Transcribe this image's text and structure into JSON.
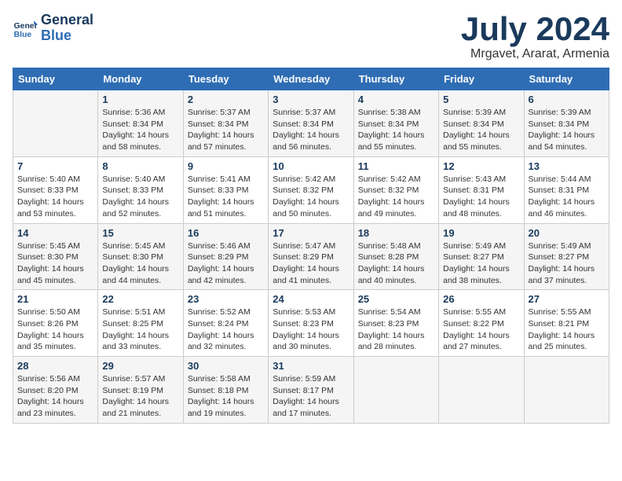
{
  "logo": {
    "line1": "General",
    "line2": "Blue"
  },
  "title": "July 2024",
  "location": "Mrgavet, Ararat, Armenia",
  "days_of_week": [
    "Sunday",
    "Monday",
    "Tuesday",
    "Wednesday",
    "Thursday",
    "Friday",
    "Saturday"
  ],
  "weeks": [
    [
      {
        "day": "",
        "info": ""
      },
      {
        "day": "1",
        "info": "Sunrise: 5:36 AM\nSunset: 8:34 PM\nDaylight: 14 hours\nand 58 minutes."
      },
      {
        "day": "2",
        "info": "Sunrise: 5:37 AM\nSunset: 8:34 PM\nDaylight: 14 hours\nand 57 minutes."
      },
      {
        "day": "3",
        "info": "Sunrise: 5:37 AM\nSunset: 8:34 PM\nDaylight: 14 hours\nand 56 minutes."
      },
      {
        "day": "4",
        "info": "Sunrise: 5:38 AM\nSunset: 8:34 PM\nDaylight: 14 hours\nand 55 minutes."
      },
      {
        "day": "5",
        "info": "Sunrise: 5:39 AM\nSunset: 8:34 PM\nDaylight: 14 hours\nand 55 minutes."
      },
      {
        "day": "6",
        "info": "Sunrise: 5:39 AM\nSunset: 8:34 PM\nDaylight: 14 hours\nand 54 minutes."
      }
    ],
    [
      {
        "day": "7",
        "info": "Sunrise: 5:40 AM\nSunset: 8:33 PM\nDaylight: 14 hours\nand 53 minutes."
      },
      {
        "day": "8",
        "info": "Sunrise: 5:40 AM\nSunset: 8:33 PM\nDaylight: 14 hours\nand 52 minutes."
      },
      {
        "day": "9",
        "info": "Sunrise: 5:41 AM\nSunset: 8:33 PM\nDaylight: 14 hours\nand 51 minutes."
      },
      {
        "day": "10",
        "info": "Sunrise: 5:42 AM\nSunset: 8:32 PM\nDaylight: 14 hours\nand 50 minutes."
      },
      {
        "day": "11",
        "info": "Sunrise: 5:42 AM\nSunset: 8:32 PM\nDaylight: 14 hours\nand 49 minutes."
      },
      {
        "day": "12",
        "info": "Sunrise: 5:43 AM\nSunset: 8:31 PM\nDaylight: 14 hours\nand 48 minutes."
      },
      {
        "day": "13",
        "info": "Sunrise: 5:44 AM\nSunset: 8:31 PM\nDaylight: 14 hours\nand 46 minutes."
      }
    ],
    [
      {
        "day": "14",
        "info": "Sunrise: 5:45 AM\nSunset: 8:30 PM\nDaylight: 14 hours\nand 45 minutes."
      },
      {
        "day": "15",
        "info": "Sunrise: 5:45 AM\nSunset: 8:30 PM\nDaylight: 14 hours\nand 44 minutes."
      },
      {
        "day": "16",
        "info": "Sunrise: 5:46 AM\nSunset: 8:29 PM\nDaylight: 14 hours\nand 42 minutes."
      },
      {
        "day": "17",
        "info": "Sunrise: 5:47 AM\nSunset: 8:29 PM\nDaylight: 14 hours\nand 41 minutes."
      },
      {
        "day": "18",
        "info": "Sunrise: 5:48 AM\nSunset: 8:28 PM\nDaylight: 14 hours\nand 40 minutes."
      },
      {
        "day": "19",
        "info": "Sunrise: 5:49 AM\nSunset: 8:27 PM\nDaylight: 14 hours\nand 38 minutes."
      },
      {
        "day": "20",
        "info": "Sunrise: 5:49 AM\nSunset: 8:27 PM\nDaylight: 14 hours\nand 37 minutes."
      }
    ],
    [
      {
        "day": "21",
        "info": "Sunrise: 5:50 AM\nSunset: 8:26 PM\nDaylight: 14 hours\nand 35 minutes."
      },
      {
        "day": "22",
        "info": "Sunrise: 5:51 AM\nSunset: 8:25 PM\nDaylight: 14 hours\nand 33 minutes."
      },
      {
        "day": "23",
        "info": "Sunrise: 5:52 AM\nSunset: 8:24 PM\nDaylight: 14 hours\nand 32 minutes."
      },
      {
        "day": "24",
        "info": "Sunrise: 5:53 AM\nSunset: 8:23 PM\nDaylight: 14 hours\nand 30 minutes."
      },
      {
        "day": "25",
        "info": "Sunrise: 5:54 AM\nSunset: 8:23 PM\nDaylight: 14 hours\nand 28 minutes."
      },
      {
        "day": "26",
        "info": "Sunrise: 5:55 AM\nSunset: 8:22 PM\nDaylight: 14 hours\nand 27 minutes."
      },
      {
        "day": "27",
        "info": "Sunrise: 5:55 AM\nSunset: 8:21 PM\nDaylight: 14 hours\nand 25 minutes."
      }
    ],
    [
      {
        "day": "28",
        "info": "Sunrise: 5:56 AM\nSunset: 8:20 PM\nDaylight: 14 hours\nand 23 minutes."
      },
      {
        "day": "29",
        "info": "Sunrise: 5:57 AM\nSunset: 8:19 PM\nDaylight: 14 hours\nand 21 minutes."
      },
      {
        "day": "30",
        "info": "Sunrise: 5:58 AM\nSunset: 8:18 PM\nDaylight: 14 hours\nand 19 minutes."
      },
      {
        "day": "31",
        "info": "Sunrise: 5:59 AM\nSunset: 8:17 PM\nDaylight: 14 hours\nand 17 minutes."
      },
      {
        "day": "",
        "info": ""
      },
      {
        "day": "",
        "info": ""
      },
      {
        "day": "",
        "info": ""
      }
    ]
  ]
}
